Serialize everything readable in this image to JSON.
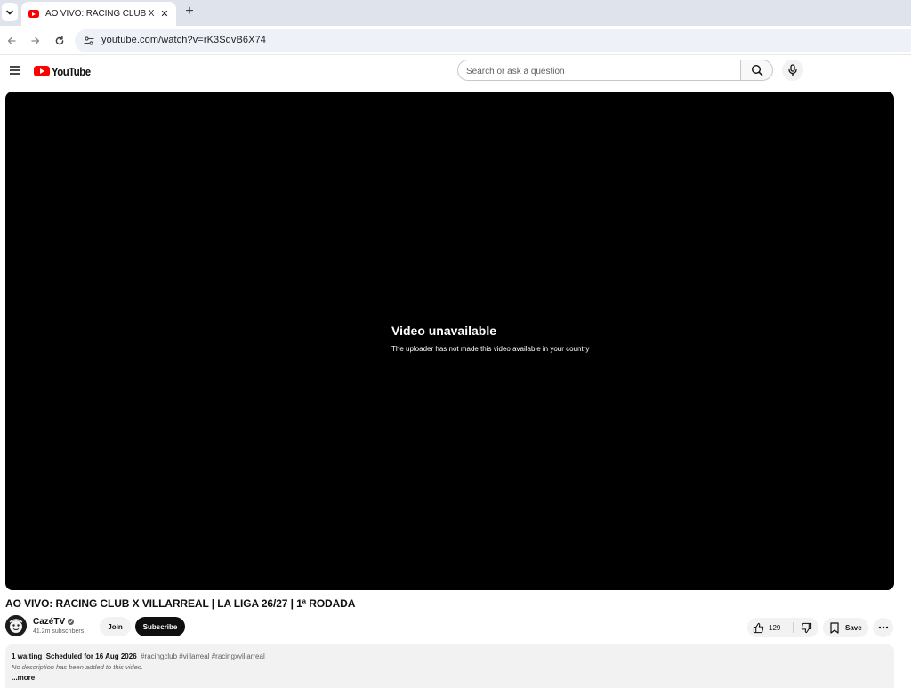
{
  "browser": {
    "tab_title": "AO VIVO: RACING CLUB X VILLA",
    "tab_close": "✕",
    "new_tab": "+",
    "url": "youtube.com/watch?v=rK3SqvB6X74"
  },
  "youtube": {
    "logo_text": "YouTube",
    "search_placeholder": "Search or ask a question"
  },
  "player": {
    "error_title": "Video unavailable",
    "error_message": "The uploader has not made this video available in your country"
  },
  "video": {
    "title": "AO VIVO: RACING CLUB X VILLARREAL | LA LIGA 26/27 | 1ª RODADA",
    "channel_name": "CazéTV",
    "subscribers": "41.2m subscribers",
    "join_label": "Join",
    "subscribe_label": "Subscribe",
    "like_count": "129",
    "save_label": "Save"
  },
  "description": {
    "waiting": "1 waiting",
    "scheduled": "Scheduled for 16 Aug 2026",
    "hashtags": "#racingclub #villarreal #racingxvillarreal",
    "text": "No description has been added to this video.",
    "more": "...more"
  },
  "icons": {
    "tab_list": "chevron-down-icon",
    "back": "arrow-left-icon",
    "forward": "arrow-right-icon",
    "reload": "reload-icon",
    "site_info": "tune-icon",
    "menu": "hamburger-icon",
    "search": "search-icon",
    "mic": "microphone-icon",
    "like": "thumbs-up-icon",
    "dislike": "thumbs-down-icon",
    "save": "bookmark-icon",
    "more": "more-horizontal-icon",
    "verified": "verified-check-icon"
  },
  "colors": {
    "brand_red": "#ff0000",
    "player_bg": "#000000",
    "subscribe_bg": "#0f0f0f",
    "pill_bg": "#f2f2f2",
    "tabstrip_bg": "#dfe3eb",
    "secondary_text": "#606060"
  }
}
